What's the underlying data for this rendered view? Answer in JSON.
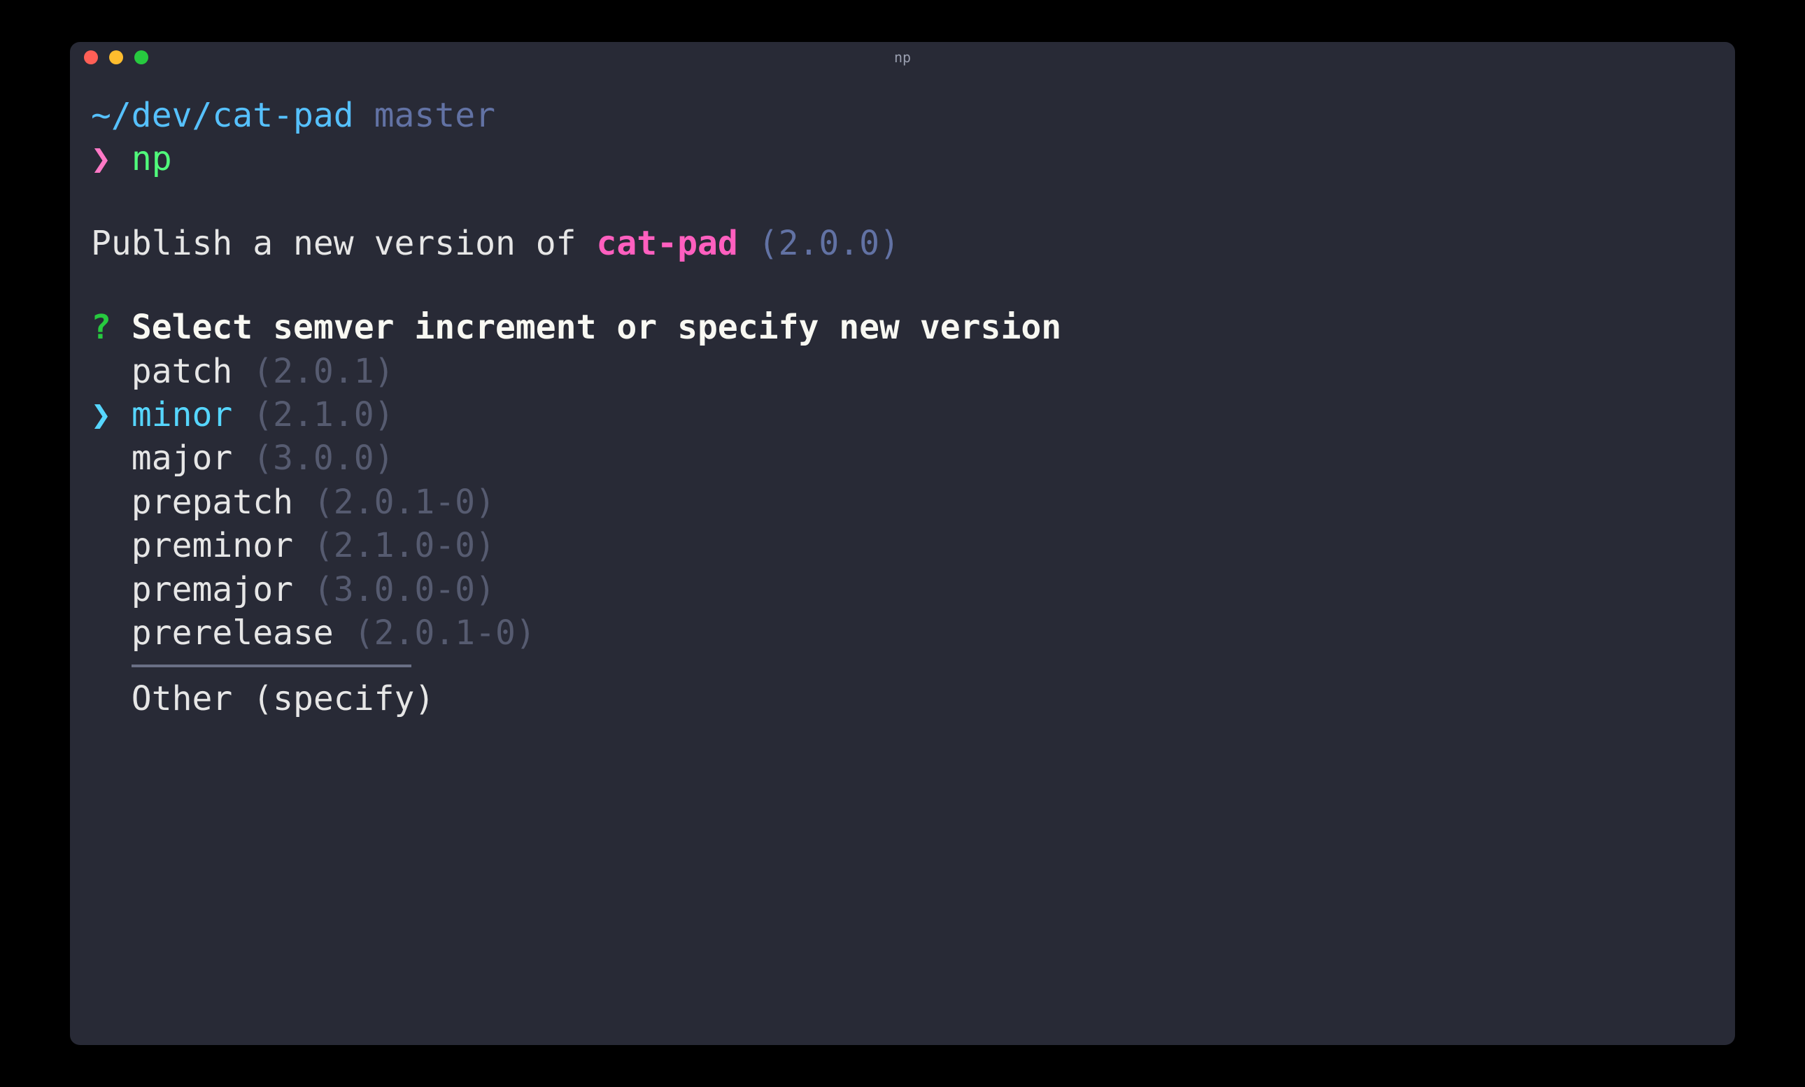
{
  "window": {
    "title": "np"
  },
  "prompt": {
    "cwd": "~/dev/cat-pad",
    "branch": "master",
    "arrow": "❯",
    "command": "np"
  },
  "publish": {
    "prefix": "Publish a new version of ",
    "package": "cat-pad",
    "version_paren": "(2.0.0)"
  },
  "question": {
    "mark": "?",
    "text": "Select semver increment or specify new version"
  },
  "options": {
    "cursor": "❯",
    "selected_index": 1,
    "items": [
      {
        "label": "patch",
        "version": "(2.0.1)"
      },
      {
        "label": "minor",
        "version": "(2.1.0)"
      },
      {
        "label": "major",
        "version": "(3.0.0)"
      },
      {
        "label": "prepatch",
        "version": "(2.0.1-0)"
      },
      {
        "label": "preminor",
        "version": "(2.1.0-0)"
      },
      {
        "label": "premajor",
        "version": "(3.0.0-0)"
      },
      {
        "label": "prerelease",
        "version": "(2.0.1-0)"
      }
    ],
    "other": "Other (specify)"
  }
}
